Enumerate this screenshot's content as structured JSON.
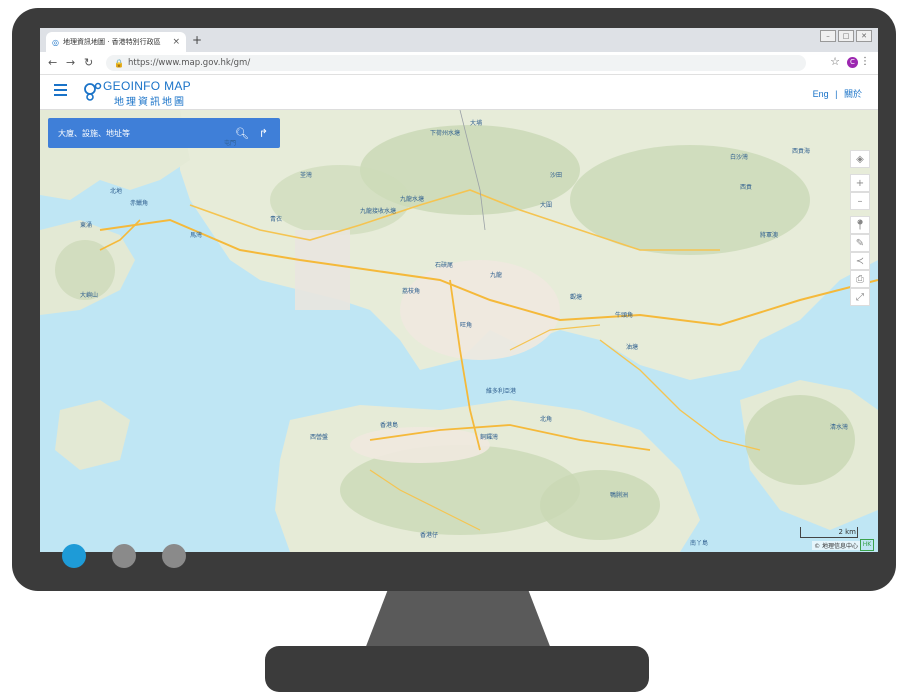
{
  "browser": {
    "tab_title": "地理資訊地圖 · 香港特別行政區",
    "tab_close": "×",
    "new_tab": "+",
    "url": "https://www.map.gov.hk/gm/",
    "window_controls": [
      "–",
      "□",
      "✕"
    ],
    "profile_initial": "C"
  },
  "header": {
    "logo_en": "GEOINFO MAP",
    "logo_zh": "地理資訊地圖",
    "lang_en": "Eng",
    "lang_sep": "|",
    "lang_zh": "關於"
  },
  "search": {
    "placeholder": "大廈、設施、地址等"
  },
  "map": {
    "labels": [
      "北地",
      "下荷州水塘",
      "九龍水塘",
      "九龍接收水塘",
      "大埔",
      "白沙灣",
      "西貢海",
      "大圍",
      "九龍",
      "旺角",
      "觀塘",
      "油塘",
      "維多利亞港",
      "香港島",
      "北角",
      "西營盤",
      "香港仔",
      "南丫島",
      "銅鑼灣",
      "東涌",
      "將軍澳",
      "清水灣",
      "大嶼山",
      "鴨脷洲",
      "赤鱲角",
      "石硤尾",
      "荔枝角",
      "牛頭角",
      "馬灣",
      "沙田",
      "青衣",
      "荃灣",
      "西貢",
      "屯門"
    ],
    "scale_text": "2 km",
    "copyright": "© 地理信息中心",
    "badge": "HK"
  }
}
